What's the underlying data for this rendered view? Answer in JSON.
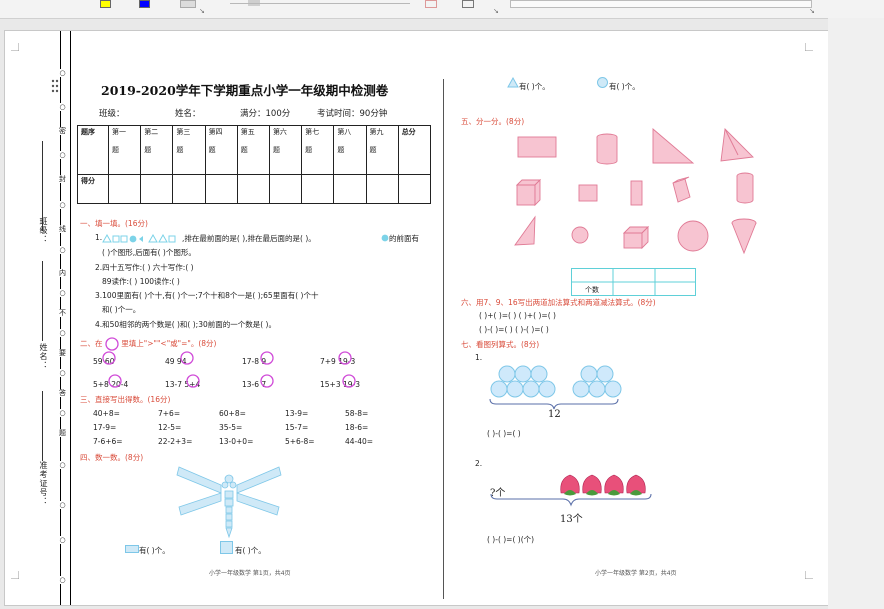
{
  "ribbon": {
    "glyphs": [
      "↘",
      "↘",
      "↘"
    ]
  },
  "binding": {
    "seals": [
      "○",
      "○",
      "○",
      "○",
      "○",
      "○",
      "○",
      "○",
      "○",
      "○",
      "○",
      "○",
      "○"
    ],
    "labels": [
      "密",
      "封",
      "线",
      "内",
      "不",
      "要",
      "答",
      "题"
    ],
    "side_labels": [
      "班级：",
      "姓名：",
      "准考证号："
    ]
  },
  "title": "2019-2020学年下学期重点小学一年级期中检测卷",
  "info": {
    "class": "班级：",
    "name": "姓名：",
    "full": "满分：100分",
    "time": "考试时间：90分钟"
  },
  "score_table": {
    "head": [
      "题序",
      "第一",
      "第二",
      "第三",
      "第四",
      "第五",
      "第六",
      "第七",
      "第八",
      "第九",
      "总分"
    ],
    "sub": "题",
    "row2": "得分"
  },
  "q1": {
    "title": "一、填一填。(16分)",
    "l1a": "1.",
    "l1b": ",排在最前面的是(      ),排在最后面的是(      )。",
    "l1c": "的前面有",
    "l1d": "(      )个图形,后面有(      )个图形。",
    "l2a": "2.四十五写作:(            )        六十写作:(            )",
    "l2b": "89读作:(            )        100读作:(              )",
    "l3a": "3.100里面有(      )个十,有(      )个一;7个十和8个一是(      );65里面有(      )个十",
    "l3b": "和(      )个一。",
    "l4": "4.和50相邻的两个数是(      )和(      );30前面的一个数是(      )。"
  },
  "q2": {
    "title_a": "二、在",
    "title_b": "里填上\">\"\"<\"或\"=\"。(8分)",
    "items": [
      "59  60",
      "49  94",
      "17-8  9",
      "7+9  19-3",
      "5+8  20-4",
      "13-7  5+4",
      "13-6  7",
      "15+3  19-3"
    ]
  },
  "q3": {
    "title": "三、直接写出得数。(16分)",
    "rows": [
      [
        "40+8=",
        "7+6=",
        "60+8=",
        "13-9=",
        "58-8="
      ],
      [
        "17-9=",
        "12-5=",
        "35-5=",
        "15-7=",
        "18-6="
      ],
      [
        "7-6+6=",
        "22-2+3=",
        "13-0+0=",
        "5+6-8=",
        "44-40="
      ]
    ]
  },
  "q4": {
    "title": "四、数一数。(8分)",
    "c1": "有(      )个。",
    "c2": "有(      )个。"
  },
  "right_top": {
    "c1": "有(      )个。",
    "c2": "有(      )个。"
  },
  "q5": {
    "title": "五、分一分。(8分)",
    "table_label": "个数"
  },
  "q6": {
    "title": "六、用7、9、16写出两道加法算式和两道减法算式。(8分)",
    "r1": "(      )+(      )=(      )        (      )+(      )=(      )",
    "r2": "(      )-(      )=(      )        (      )-(      )=(      )"
  },
  "q7": {
    "title": "七、看图列算式。(8分)",
    "n1": "1.",
    "total1": "12",
    "eq1": "(      )-(      )=(      )",
    "n2": "2.",
    "unknown": "?个",
    "total2": "13个",
    "eq2": "(      )-(      )=(      )(个)"
  },
  "footer": {
    "left": "小学一年级数学  第1页，共4页",
    "right": "小学一年级数学  第2页，共4页"
  },
  "colors": {
    "pink": "#f4a7b9",
    "pink_stroke": "#e07a95",
    "cyan": "#9fe3ef",
    "blue_circle": "#cfe9fb",
    "red_title": "#d94b3a"
  }
}
